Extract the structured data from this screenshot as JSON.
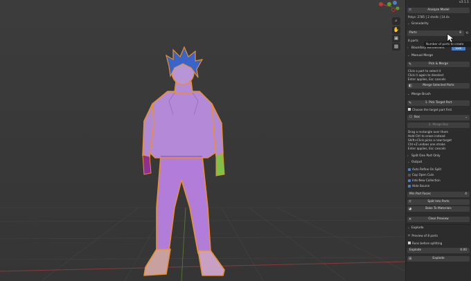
{
  "app": {
    "version": "v3.1.1",
    "corner_label": ""
  },
  "viewport": {
    "accent_x": "#c0392b",
    "accent_y": "#5b9e2f",
    "grid": "#444444",
    "figure_fill": "#b281d8",
    "hair": "#3d63c8",
    "outline": "#e8902d"
  },
  "panel": {
    "analyze_label": "Analyze Model",
    "stats": [
      "Polys: 2785",
      "2 shells",
      "14.4s"
    ],
    "granularity_header": "Granularity",
    "parts_label": "Parts",
    "parts_value": "8",
    "tooltip": "Number of parts to create",
    "parts_note": "8 parts",
    "boundary_header": "Boundary Refinement",
    "boundary_badge": "Live",
    "manual_merge_header": "Manual Merge",
    "pick_merge_label": "Pick & Merge",
    "merge_instructions": [
      "Click a part to select it",
      "Click it again to deselect",
      "Enter applies, Esc cancels"
    ],
    "merge_selected_label": "Merge Selected Parts",
    "merge_brush_header": "Merge Brush",
    "pick_target_label": "1. Pick Target Part",
    "choose_target_text": "Choose the target part first",
    "box_label": "Box",
    "merge_box_label": "2. Merge Box",
    "brush_instructions": [
      "Drag a rectangle over them",
      "Hold Ctrl to erase instead",
      "Shift+Click picks a new target",
      "Ctrl+Z undoes one stroke",
      "Enter applies, Esc cancels"
    ],
    "split_header": "Split One Part Only",
    "output_header": "Output",
    "checks": [
      {
        "label": "Auto Refine On Split",
        "on": true
      },
      {
        "label": "Cap Open Cuts",
        "on": false
      },
      {
        "label": "Into New Collection",
        "on": true
      },
      {
        "label": "Hide Source",
        "on": true
      }
    ],
    "min_part_label": "Min Part Faces",
    "min_part_value": "4",
    "split_parts_label": "Split Into Parts",
    "bake_label": "Bake To Materials",
    "clear_preview_label": "Clear Preview",
    "explode_header": "Explode",
    "preview_text": "Preview of 8 parts",
    "runs_text": "Runs before splitting",
    "explode_field_label": "Explode",
    "explode_field_value": "0.00",
    "explode_button_label": "Explode"
  }
}
